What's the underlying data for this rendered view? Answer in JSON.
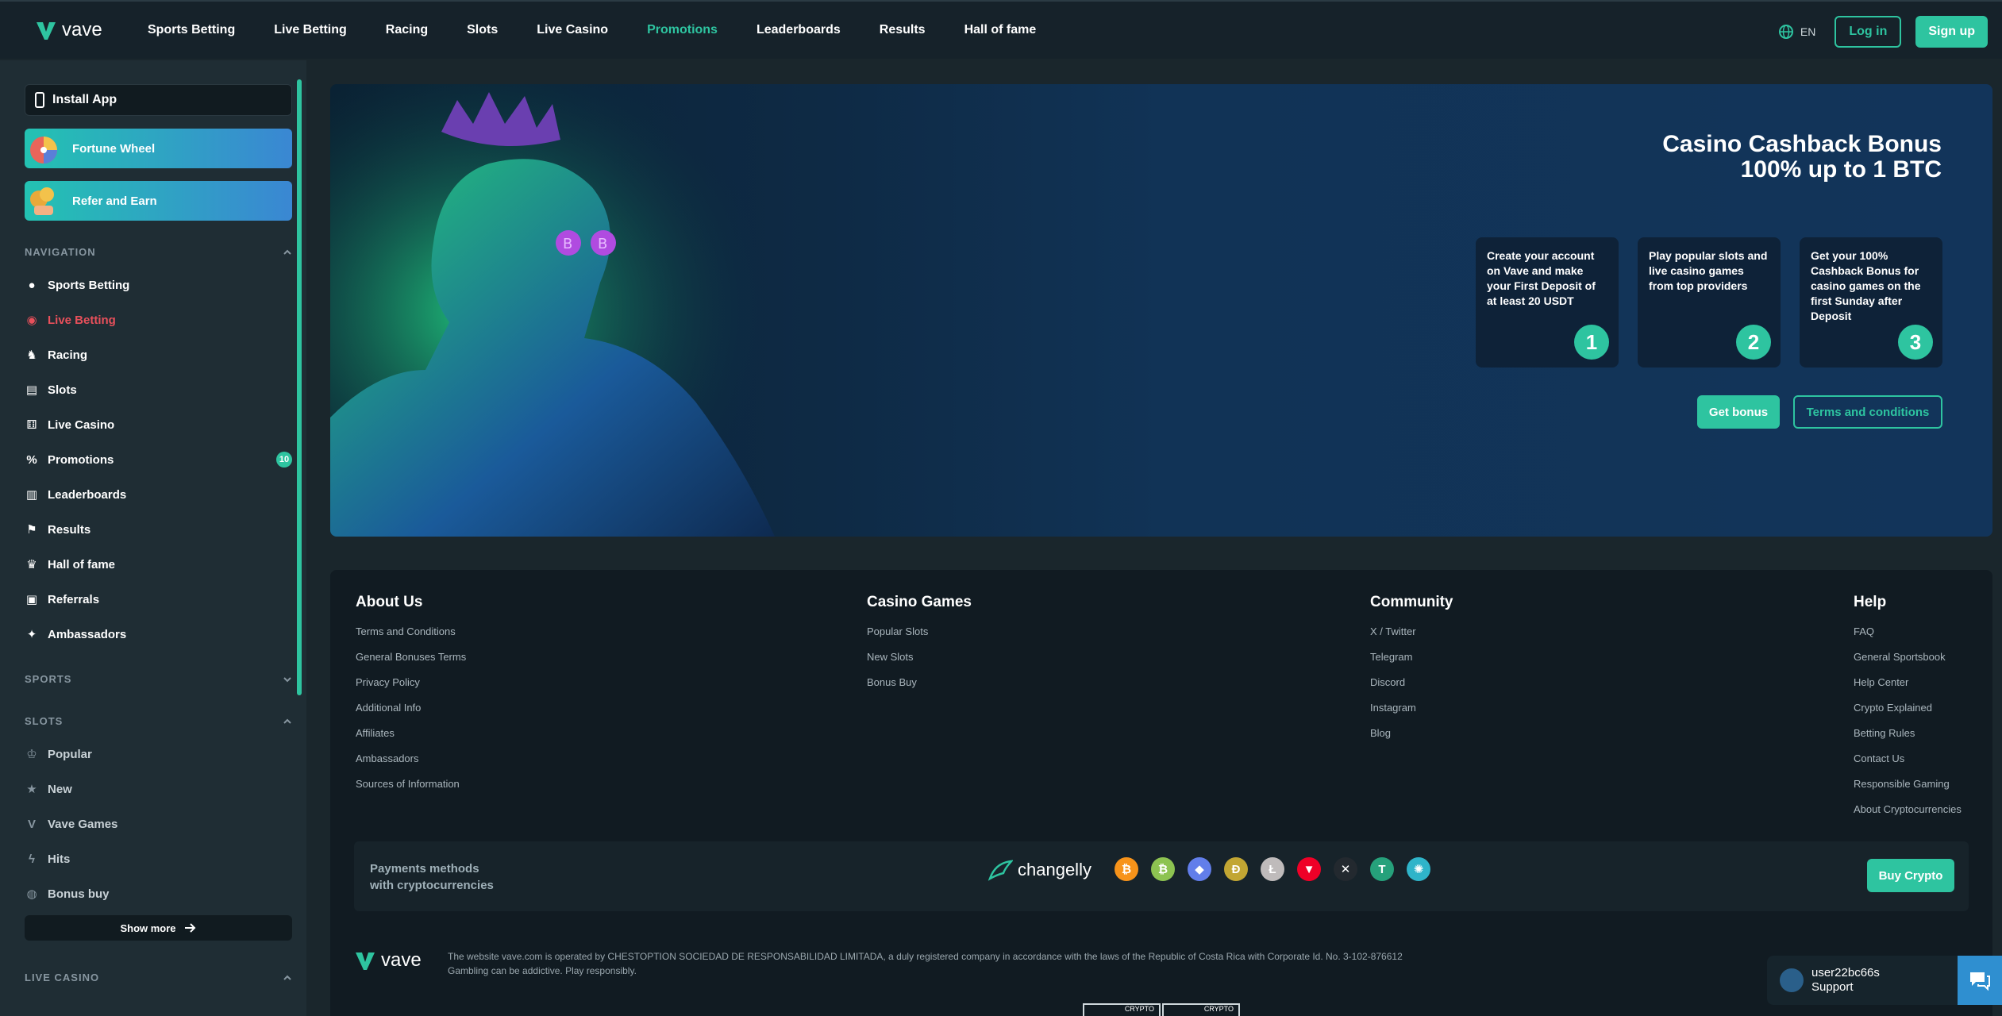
{
  "header": {
    "logo": "vave",
    "nav": [
      "Sports Betting",
      "Live Betting",
      "Racing",
      "Slots",
      "Live Casino",
      "Promotions",
      "Leaderboards",
      "Results",
      "Hall of fame"
    ],
    "active_nav": "Promotions",
    "lang": "EN",
    "login": "Log in",
    "signup": "Sign up"
  },
  "sidebar": {
    "install": "Install App",
    "fortune": "Fortune Wheel",
    "refer": "Refer and Earn",
    "nav_title": "NAVIGATION",
    "nav_items": [
      {
        "label": "Sports Betting",
        "icon": "sports-icon"
      },
      {
        "label": "Live Betting",
        "icon": "live-icon"
      },
      {
        "label": "Racing",
        "icon": "horse-icon"
      },
      {
        "label": "Slots",
        "icon": "slots-icon"
      },
      {
        "label": "Live Casino",
        "icon": "dice-icon"
      },
      {
        "label": "Promotions",
        "icon": "promo-icon",
        "badge": "10"
      },
      {
        "label": "Leaderboards",
        "icon": "leaderboard-icon"
      },
      {
        "label": "Results",
        "icon": "flag-icon"
      },
      {
        "label": "Hall of fame",
        "icon": "trophy-icon"
      },
      {
        "label": "Referrals",
        "icon": "gift-icon"
      },
      {
        "label": "Ambassadors",
        "icon": "handshake-icon"
      }
    ],
    "sports_title": "SPORTS",
    "slots_title": "SLOTS",
    "slot_items": [
      {
        "label": "Popular",
        "icon": "crown-icon"
      },
      {
        "label": "New",
        "icon": "star-icon"
      },
      {
        "label": "Vave Games",
        "icon": "vave-icon"
      },
      {
        "label": "Hits",
        "icon": "lightning-icon"
      },
      {
        "label": "Bonus buy",
        "icon": "bag-icon"
      }
    ],
    "show_more": "Show more",
    "live_casino_title": "LIVE CASINO"
  },
  "hero": {
    "title_line1": "Casino Cashback Bonus",
    "title_line2": "100% up to 1 BTC",
    "steps": [
      {
        "text": "Create your account on Vave and make your First Deposit of at least 20 USDT",
        "num": "1"
      },
      {
        "text": "Play popular slots and live casino games from top providers",
        "num": "2"
      },
      {
        "text": "Get your 100% Cashback Bonus for casino games on the first Sunday after Deposit",
        "num": "3"
      }
    ],
    "get_bonus": "Get bonus",
    "terms": "Terms and conditions"
  },
  "footer": {
    "about": {
      "title": "About Us",
      "links": [
        "Terms and Conditions",
        "General Bonuses Terms",
        "Privacy Policy",
        "Additional Info",
        "Affiliates",
        "Ambassadors",
        "Sources of Information"
      ]
    },
    "casino": {
      "title": "Casino Games",
      "links": [
        "Popular Slots",
        "New Slots",
        "Bonus Buy"
      ]
    },
    "community": {
      "title": "Community",
      "links": [
        "X / Twitter",
        "Telegram",
        "Discord",
        "Instagram",
        "Blog"
      ]
    },
    "help": {
      "title": "Help",
      "links": [
        "FAQ",
        "General Sportsbook",
        "Help Center",
        "Crypto Explained",
        "Betting Rules",
        "Contact Us",
        "Responsible Gaming",
        "About Cryptocurrencies"
      ]
    },
    "payments_line1": "Payments methods",
    "payments_line2": "with cryptocurrencies",
    "changelly": "changelly",
    "coins": [
      {
        "name": "bitcoin-icon",
        "color": "#f7931a",
        "glyph": "₿"
      },
      {
        "name": "bitcoin-cash-icon",
        "color": "#8dc351",
        "glyph": "₿"
      },
      {
        "name": "ethereum-icon",
        "color": "#627eea",
        "glyph": "◆"
      },
      {
        "name": "dogecoin-icon",
        "color": "#c2a633",
        "glyph": "Ð"
      },
      {
        "name": "litecoin-icon",
        "color": "#bfbbbb",
        "glyph": "Ł"
      },
      {
        "name": "tron-icon",
        "color": "#ef0027",
        "glyph": "▼"
      },
      {
        "name": "xrp-icon",
        "color": "#23292f",
        "glyph": "✕"
      },
      {
        "name": "tether-icon",
        "color": "#26a17b",
        "glyph": "T"
      },
      {
        "name": "cardano-icon",
        "color": "#2fb4c9",
        "glyph": "✺"
      }
    ],
    "buy_crypto": "Buy Crypto",
    "logo": "vave",
    "legal_line1": "The website vave.com is operated by CHESTOPTION SOCIEDAD DE RESPONSABILIDAD LIMITADA, a duly registered company in accordance with the laws of the Republic of Costa Rica with Corporate Id. No. 3-102-876612",
    "legal_line2": "Gambling can be addictive. Play responsibly.",
    "cert_label": "CRYPTO"
  },
  "support": {
    "user": "user22bc66s",
    "label": "Support"
  },
  "colors": {
    "accent": "#2ec4a0",
    "live": "#e8505b",
    "bg": "#1a262c"
  }
}
